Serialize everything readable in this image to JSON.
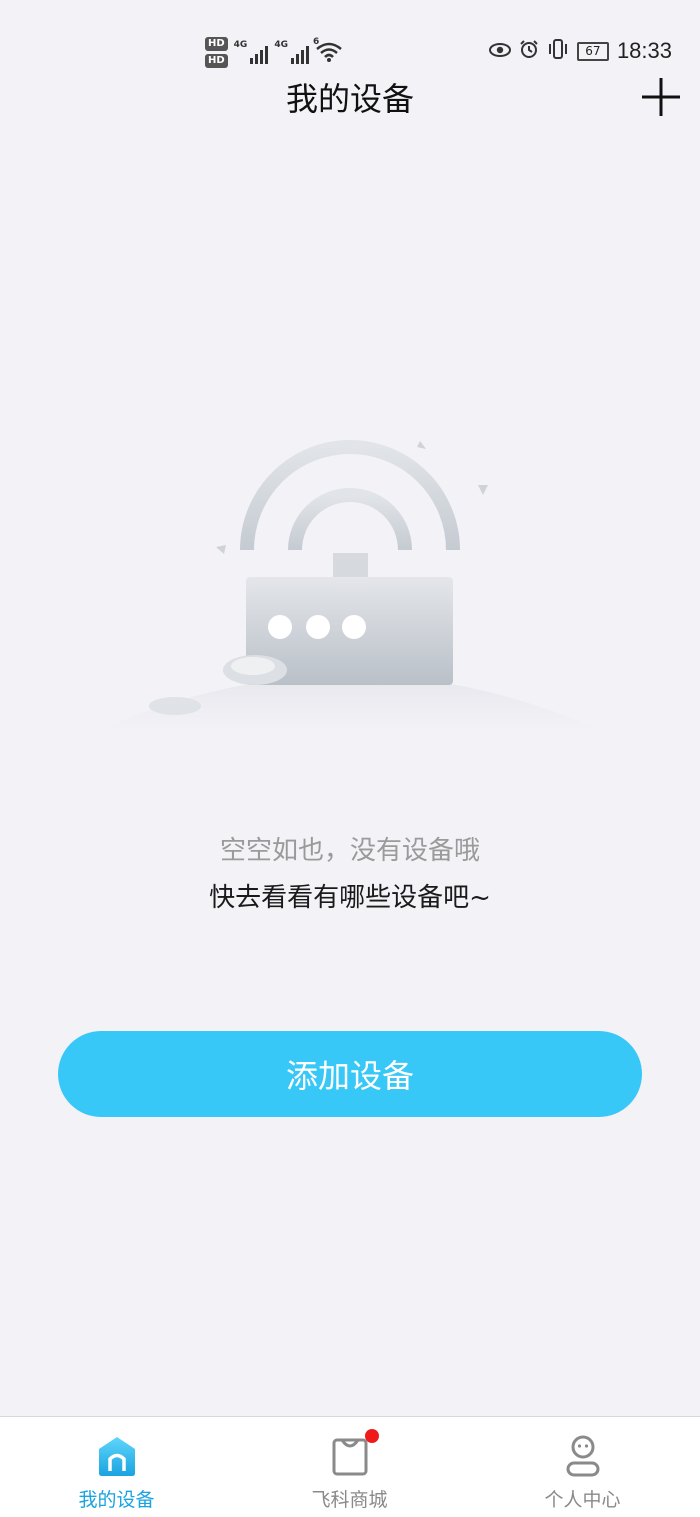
{
  "status_bar": {
    "hd1": "HD",
    "hd2": "HD",
    "net1": "4G",
    "net2": "4G",
    "wifi_badge": "6",
    "battery_level": "67",
    "time": "18:33",
    "icons": [
      "eye-icon",
      "alarm-icon",
      "vibrate-icon",
      "battery-icon"
    ]
  },
  "header": {
    "title": "我的设备",
    "add_icon": "plus-icon"
  },
  "empty_state": {
    "primary": "空空如也，没有设备哦",
    "secondary": "快去看看有哪些设备吧~"
  },
  "actions": {
    "add_device_label": "添加设备"
  },
  "tab_bar": {
    "tabs": [
      {
        "label": "我的设备",
        "icon": "home-icon",
        "active": true
      },
      {
        "label": "飞科商城",
        "icon": "shopping-bag-icon",
        "active": false,
        "badge": true
      },
      {
        "label": "个人中心",
        "icon": "profile-icon",
        "active": false
      }
    ]
  },
  "colors": {
    "accent": "#38c8f8",
    "tab_active": "#1aa3e0",
    "badge": "#ef1b1b",
    "background": "#f3f2f7"
  }
}
